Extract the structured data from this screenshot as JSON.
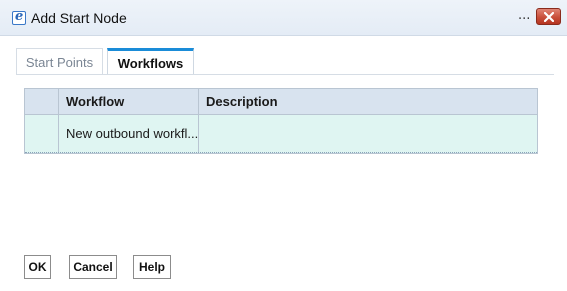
{
  "window": {
    "title": "Add Start Node",
    "ellipsis": "...",
    "app_icon": "app-e-icon",
    "close_icon": "close-icon"
  },
  "tabs": [
    {
      "label": "Start Points",
      "active": false
    },
    {
      "label": "Workflows",
      "active": true
    }
  ],
  "grid": {
    "columns": [
      "Workflow",
      "Description"
    ],
    "rows": [
      {
        "workflow": "New outbound workfl...",
        "description": ""
      }
    ]
  },
  "buttons": {
    "ok": "OK",
    "cancel": "Cancel",
    "help": "Help"
  },
  "colors": {
    "tab_accent": "#1a8cd8",
    "header_bg": "#d8e3ef",
    "row_bg": "#dff5f2",
    "close_btn": "#c94f3a"
  }
}
